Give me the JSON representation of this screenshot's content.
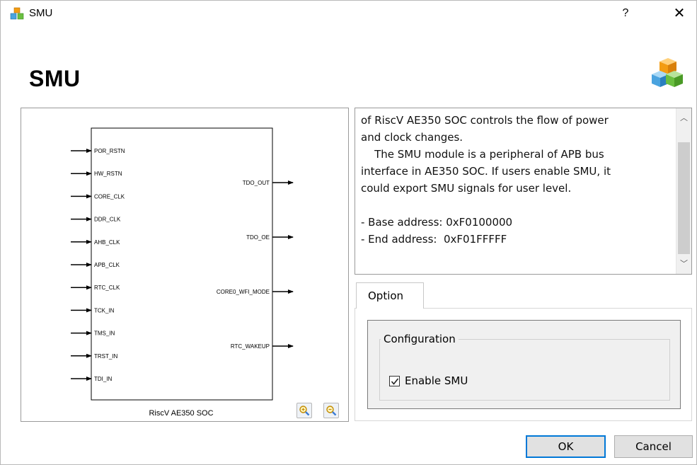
{
  "window": {
    "title": "SMU",
    "help_label": "?",
    "close_label": "✕",
    "app_icon": "cubes-icon"
  },
  "header": {
    "title": "SMU",
    "icon": "cubes-icon"
  },
  "diagram": {
    "block_label": "RiscV AE350 SOC",
    "inputs": [
      "POR_RSTN",
      "HW_RSTN",
      "CORE_CLK",
      "DDR_CLK",
      "AHB_CLK",
      "APB_CLK",
      "RTC_CLK",
      "TCK_IN",
      "TMS_IN",
      "TRST_IN",
      "TDI_IN"
    ],
    "outputs": [
      "TDO_OUT",
      "TDO_OE",
      "CORE0_WFI_MODE",
      "RTC_WAKEUP"
    ],
    "zoom_in_icon": "zoom-in-icon",
    "zoom_out_icon": "zoom-out-icon"
  },
  "description": {
    "lines": [
      "of RiscV AE350 SOC controls the flow of power",
      "and clock changes.",
      "    The SMU module is a peripheral of APB bus",
      "interface in AE350 SOC. If users enable SMU, it",
      "could export SMU signals for user level.",
      "",
      "- Base address: 0xF0100000",
      "- End address:  0xF01FFFFF"
    ]
  },
  "options": {
    "tab_label": "Option",
    "group_title": "Configuration",
    "checkbox_label": "Enable SMU",
    "checkbox_checked": true
  },
  "buttons": {
    "ok": "OK",
    "cancel": "Cancel"
  },
  "colors": {
    "accent": "#0078d7"
  }
}
